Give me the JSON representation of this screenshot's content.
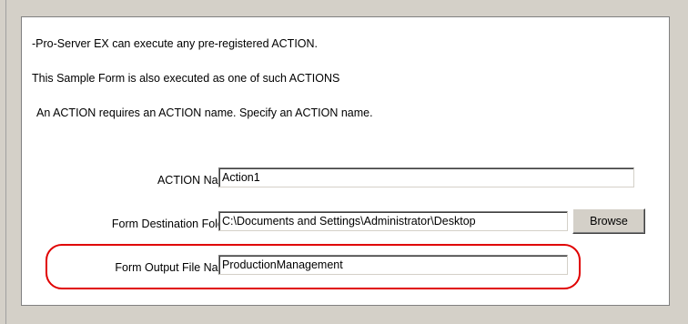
{
  "intro": {
    "line1": "-Pro-Server EX can execute any pre-registered ACTION.",
    "line2": "This Sample Form is also executed as one of such ACTIONS",
    "line3": "An ACTION requires an ACTION name. Specify an ACTION name."
  },
  "form": {
    "action_name_label": "ACTION Name",
    "action_name_value": "Action1",
    "destination_label": "Form Destination Folder",
    "destination_value": "C:\\Documents and Settings\\Administrator\\Desktop",
    "browse_label": "Browse",
    "output_label": "Form Output File Name",
    "output_value": "ProductionManagement"
  },
  "colors": {
    "highlight": "#e00000"
  }
}
